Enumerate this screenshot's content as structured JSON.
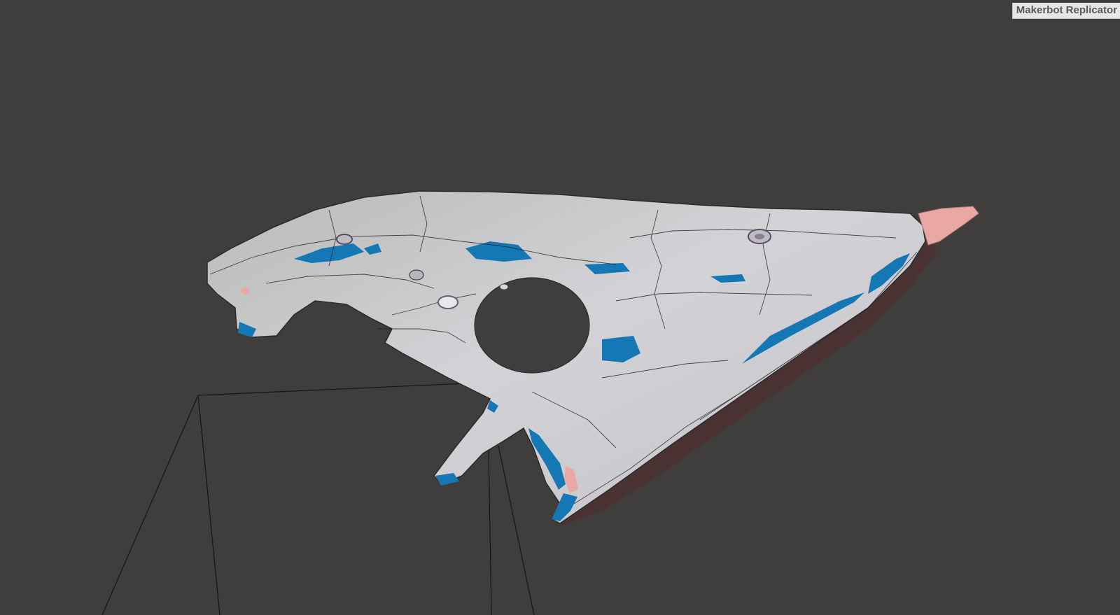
{
  "viewport": {
    "printer_name": "Makerbot Replicator",
    "background_color": "#3f3e3c",
    "model_surface_color": "#c9c8c9",
    "model_edge_color": "#1a1a1a",
    "unsupported_region_color": "#1577b4",
    "overhang_tint_color": "#e9a8a4",
    "build_volume_line_color": "#151515",
    "side_face_color": "#4b2f30"
  }
}
